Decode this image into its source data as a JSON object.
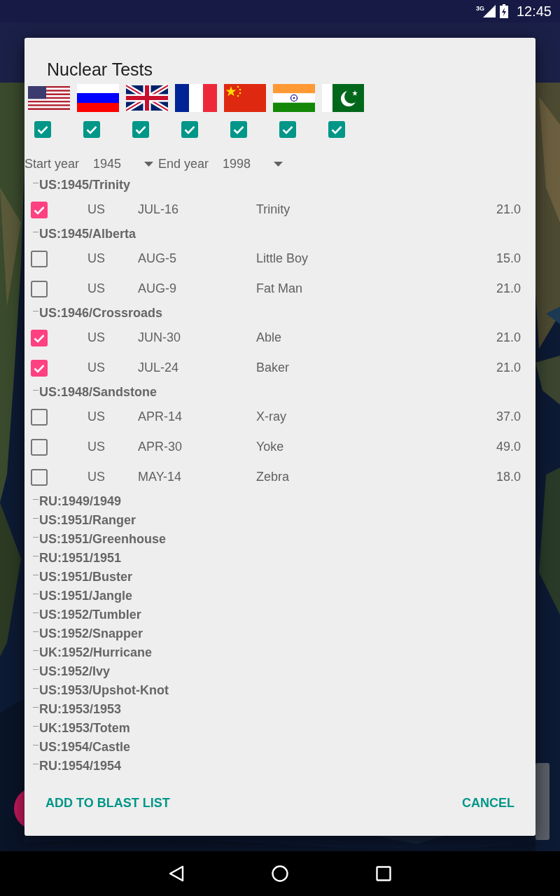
{
  "status_bar": {
    "network": "3G",
    "time": "12:45"
  },
  "dialog": {
    "title": "Nuclear Tests",
    "countries": [
      {
        "kind": "us",
        "checked": true
      },
      {
        "kind": "ru",
        "checked": true
      },
      {
        "kind": "uk",
        "checked": true
      },
      {
        "kind": "fr",
        "checked": true
      },
      {
        "kind": "cn",
        "checked": true
      },
      {
        "kind": "in",
        "checked": true
      },
      {
        "kind": "pk",
        "checked": true
      }
    ],
    "start_year": {
      "label": "Start year",
      "value": "1945"
    },
    "end_year": {
      "label": "End year",
      "value": "1998"
    },
    "groups": [
      {
        "label": "US:1945/Trinity",
        "children": [
          {
            "country": "US",
            "date": "JUL-16",
            "name": "Trinity",
            "value": "21.0",
            "checked": true
          }
        ]
      },
      {
        "label": "US:1945/Alberta",
        "children": [
          {
            "country": "US",
            "date": "AUG-5",
            "name": "Little Boy",
            "value": "15.0",
            "checked": false
          },
          {
            "country": "US",
            "date": "AUG-9",
            "name": "Fat Man",
            "value": "21.0",
            "checked": false
          }
        ]
      },
      {
        "label": "US:1946/Crossroads",
        "children": [
          {
            "country": "US",
            "date": "JUN-30",
            "name": "Able",
            "value": "21.0",
            "checked": true
          },
          {
            "country": "US",
            "date": "JUL-24",
            "name": "Baker",
            "value": "21.0",
            "checked": true
          }
        ]
      },
      {
        "label": "US:1948/Sandstone",
        "children": [
          {
            "country": "US",
            "date": "APR-14",
            "name": "X-ray",
            "value": "37.0",
            "checked": false
          },
          {
            "country": "US",
            "date": "APR-30",
            "name": "Yoke",
            "value": "49.0",
            "checked": false
          },
          {
            "country": "US",
            "date": "MAY-14",
            "name": "Zebra",
            "value": "18.0",
            "checked": false
          }
        ]
      },
      {
        "label": "RU:1949/1949"
      },
      {
        "label": "US:1951/Ranger"
      },
      {
        "label": "US:1951/Greenhouse"
      },
      {
        "label": "RU:1951/1951"
      },
      {
        "label": "US:1951/Buster"
      },
      {
        "label": "US:1951/Jangle"
      },
      {
        "label": "US:1952/Tumbler"
      },
      {
        "label": "US:1952/Snapper"
      },
      {
        "label": "UK:1952/Hurricane"
      },
      {
        "label": "US:1952/Ivy"
      },
      {
        "label": "US:1953/Upshot-Knot"
      },
      {
        "label": "RU:1953/1953"
      },
      {
        "label": "UK:1953/Totem"
      },
      {
        "label": "US:1954/Castle"
      },
      {
        "label": "RU:1954/1954"
      }
    ],
    "buttons": [
      {
        "label": "ADD TO BLAST LIST"
      },
      {
        "label": "CANCEL"
      }
    ]
  }
}
